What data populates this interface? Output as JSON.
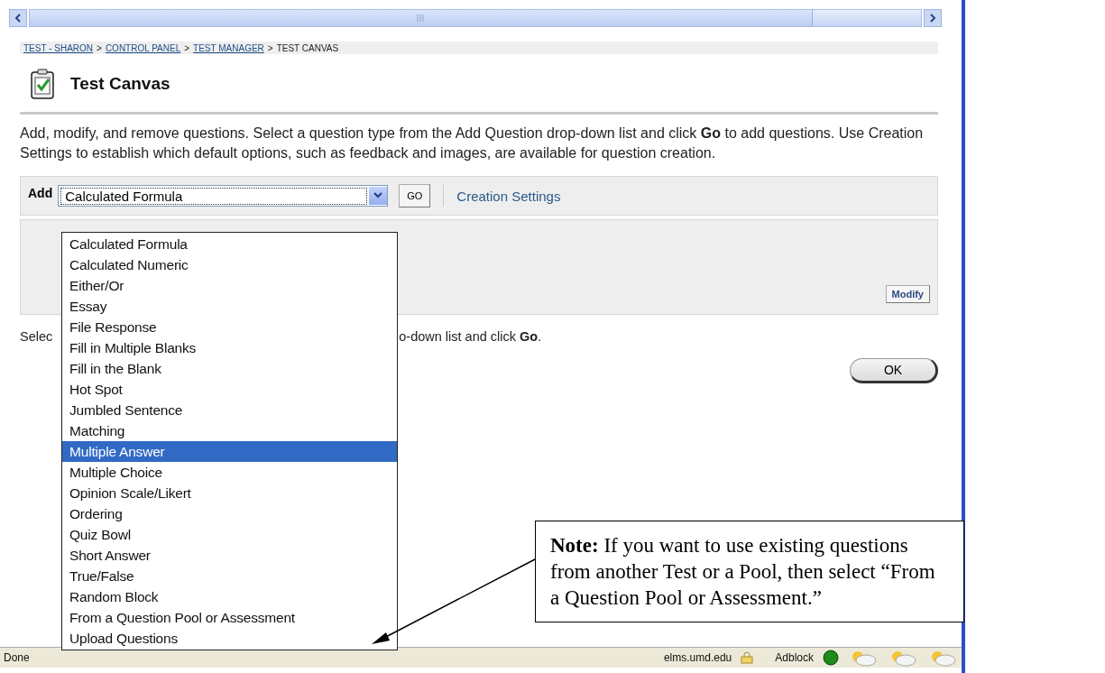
{
  "breadcrumb": [
    {
      "label": "TEST - SHARON",
      "link": true
    },
    {
      "label": "CONTROL PANEL",
      "link": true
    },
    {
      "label": "TEST MANAGER",
      "link": true
    },
    {
      "label": "TEST CANVAS",
      "link": false
    }
  ],
  "separator": ">",
  "page_title": "Test Canvas",
  "intro": "Add, modify, and remove questions. Select a question type from the Add Question drop-down list and click **Go** to add questions. Use Creation Settings to establish which default options, such as feedback and images, are available for question creation.",
  "toolbar": {
    "add_label": "Add",
    "select_value": "Calculated Formula",
    "go_button": "GO",
    "settings_link": "Creation Settings"
  },
  "modify_button": "Modify",
  "instruction_start": "Selec",
  "instruction_end": "o-down list and click **Go**.",
  "ok_button": "OK",
  "dropdown_options": [
    {
      "label": "Calculated Formula",
      "selected": false
    },
    {
      "label": "Calculated Numeric",
      "selected": false
    },
    {
      "label": "Either/Or",
      "selected": false
    },
    {
      "label": "Essay",
      "selected": false
    },
    {
      "label": "File Response",
      "selected": false
    },
    {
      "label": "Fill in Multiple Blanks",
      "selected": false
    },
    {
      "label": "Fill in the Blank",
      "selected": false
    },
    {
      "label": "Hot Spot",
      "selected": false
    },
    {
      "label": "Jumbled Sentence",
      "selected": false
    },
    {
      "label": "Matching",
      "selected": false
    },
    {
      "label": "Multiple Answer",
      "selected": true
    },
    {
      "label": "Multiple Choice",
      "selected": false
    },
    {
      "label": "Opinion Scale/Likert",
      "selected": false
    },
    {
      "label": "Ordering",
      "selected": false
    },
    {
      "label": "Quiz Bowl",
      "selected": false
    },
    {
      "label": "Short Answer",
      "selected": false
    },
    {
      "label": "True/False",
      "selected": false
    },
    {
      "label": "Random Block",
      "selected": false
    },
    {
      "label": "From a Question Pool or Assessment",
      "selected": false
    },
    {
      "label": "Upload Questions",
      "selected": false
    }
  ],
  "callout": "**Note:** If you want to use existing questions from another Test or a Pool, then select “From a Question Pool or Assessment.”",
  "status_bar": {
    "status": "Done",
    "domain": "elms.umd.edu",
    "adblock": "Adblock"
  }
}
